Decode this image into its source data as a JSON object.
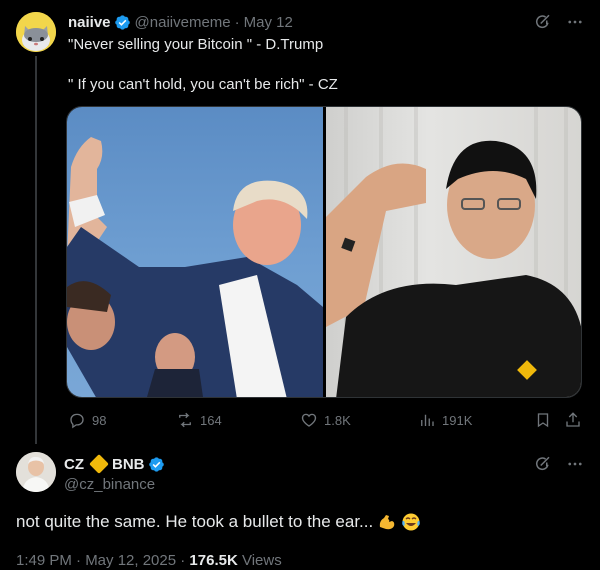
{
  "tweet": {
    "author_name": "naiive",
    "handle": "@naiivememe",
    "separator": "·",
    "date": "May 12",
    "lines": [
      "\"Never selling your Bitcoin \" - D.Trump",
      "\" If you can't hold, you can't be rich\" - CZ"
    ],
    "actions": {
      "replies": "98",
      "reposts": "164",
      "likes": "1.8K",
      "views": "191K"
    }
  },
  "reply": {
    "author_name_left": "CZ",
    "author_name_right": "BNB",
    "handle": "@cz_binance",
    "text": "not quite the same. He took a bullet to the ear...",
    "timestamp": "1:49 PM · May 12, 2025 · ",
    "views_count": "176.5K",
    "views_label": " Views"
  },
  "colors": {
    "verified": "#1d9bf0",
    "muted": "#71767b",
    "text": "#e7e9ea",
    "bnb": "#f0b90b",
    "background": "#000000"
  },
  "icons": [
    "verified-badge-icon",
    "grok-icon",
    "more-icon",
    "reply-icon",
    "repost-icon",
    "like-icon",
    "views-icon",
    "bookmark-icon",
    "share-icon",
    "flexed-biceps-emoji",
    "tears-of-joy-emoji"
  ]
}
